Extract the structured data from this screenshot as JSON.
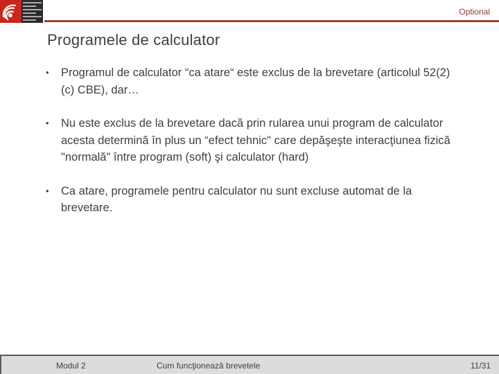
{
  "header": {
    "logo_name": "European Patent Office",
    "optional_label": "Optional",
    "accent_color": "#a33a33",
    "logo_red": "#c9261c"
  },
  "slide": {
    "title": "Programele de calculator",
    "bullets": [
      "Programul de calculator  “ca atare“ este exclus de la brevetare (articolul 52(2)(c) CBE), dar…",
      "Nu este exclus de la brevetare dacă prin rularea unui program de calculator acesta determină în plus un “efect tehnic\" care depăşeşte interacţiunea fizică \"normală\" între program (soft) şi calculator (hard)",
      "Ca atare, programele pentru calculator nu sunt  excluse automat de la brevetare."
    ],
    "bullet_glyph": "•"
  },
  "footer": {
    "module": "Modul 2",
    "title": "Cum funcţionează brevetele",
    "page": "11/31"
  }
}
